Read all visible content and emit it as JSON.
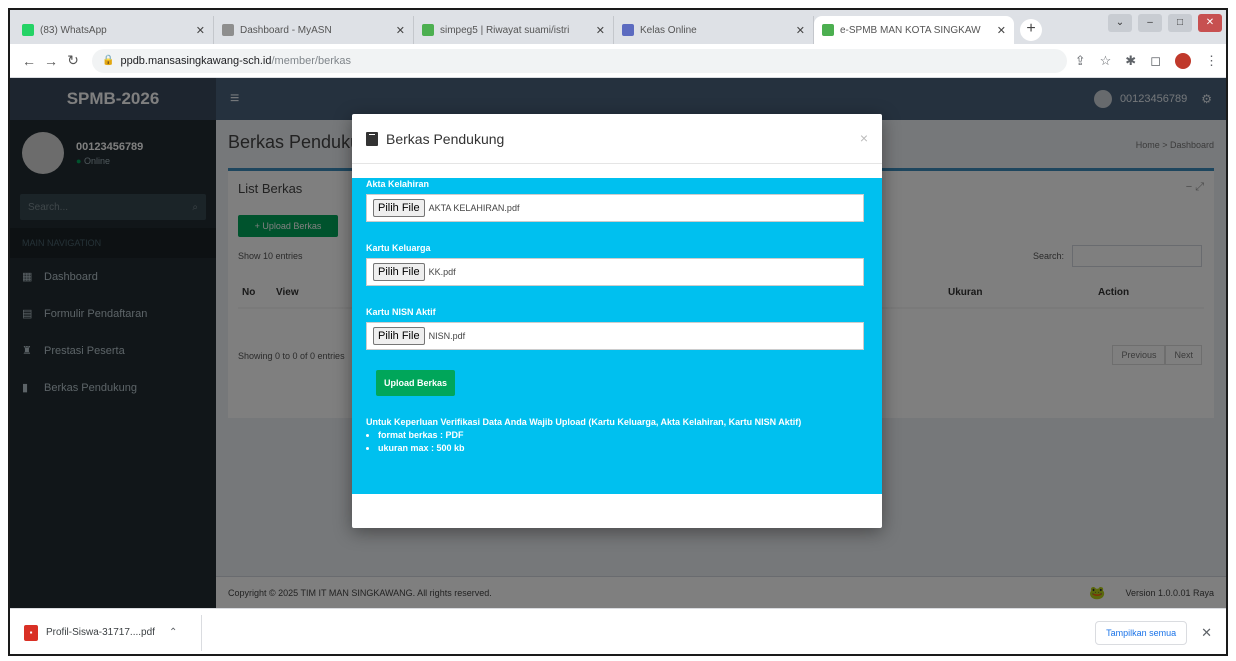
{
  "browser": {
    "tabs": [
      {
        "title": "(83) WhatsApp",
        "color": "#25d366",
        "active": false
      },
      {
        "title": "Dashboard - MyASN",
        "color": "#8e8e8e",
        "active": false
      },
      {
        "title": "simpeg5 | Riwayat suami/istri",
        "color": "#4caf50",
        "active": false
      },
      {
        "title": "Kelas Online",
        "color": "#5c6bc0",
        "active": false
      },
      {
        "title": "e-SPMB MAN KOTA SINGKAW",
        "color": "#4caf50",
        "active": true
      }
    ],
    "address_host": "ppdb.mansasingkawang-sch.id",
    "address_path": "/member/berkas"
  },
  "app": {
    "brand": "SPMB-2026",
    "topnav_user": "00123456789",
    "sidebar": {
      "user_name": "00123456789",
      "user_status": "Online",
      "search_placeholder": "Search...",
      "header": "MAIN NAVIGATION",
      "items": [
        {
          "label": "Dashboard",
          "icon": "dashboard-icon"
        },
        {
          "label": "Formulir Pendaftaran",
          "icon": "form-icon"
        },
        {
          "label": "Prestasi Peserta",
          "icon": "trophy-icon"
        },
        {
          "label": "Berkas Pendukung",
          "icon": "file-icon"
        }
      ]
    },
    "content": {
      "page_title": "Berkas Pendukung",
      "breadcrumb": "Home > Dashboard",
      "box_title": "List Berkas",
      "upload_button": "+ Upload Berkas",
      "show_label": "Show 10 entries",
      "search_label": "Search:",
      "columns": [
        "No",
        "View",
        "Ukuran",
        "Action"
      ],
      "showing": "Showing 0 to 0 of 0 entries",
      "pager_prev": "Previous",
      "pager_next": "Next"
    },
    "footer": {
      "copyright": "Copyright © 2025 TIM IT MAN SINGKAWANG. All rights reserved.",
      "version": "Version 1.0.0.01 Raya"
    }
  },
  "modal": {
    "title": "Berkas Pendukung",
    "fields": [
      {
        "label": "Akta Kelahiran",
        "button": "Pilih File",
        "file": "AKTA KELAHIRAN.pdf"
      },
      {
        "label": "Kartu Keluarga",
        "button": "Pilih File",
        "file": "KK.pdf"
      },
      {
        "label": "Kartu NISN Aktif",
        "button": "Pilih File",
        "file": "NISN.pdf"
      }
    ],
    "upload_button": "Upload Berkas",
    "note": "Untuk Keperluan Verifikasi Data Anda Wajib Upload (Kartu Keluarga, Akta Kelahiran, Kartu NISN Aktif)",
    "rules": [
      "format berkas : PDF",
      "ukuran max : 500 kb"
    ]
  },
  "downloads": {
    "file": "Profil-Siswa-31717....pdf",
    "show_all": "Tampilkan semua"
  }
}
